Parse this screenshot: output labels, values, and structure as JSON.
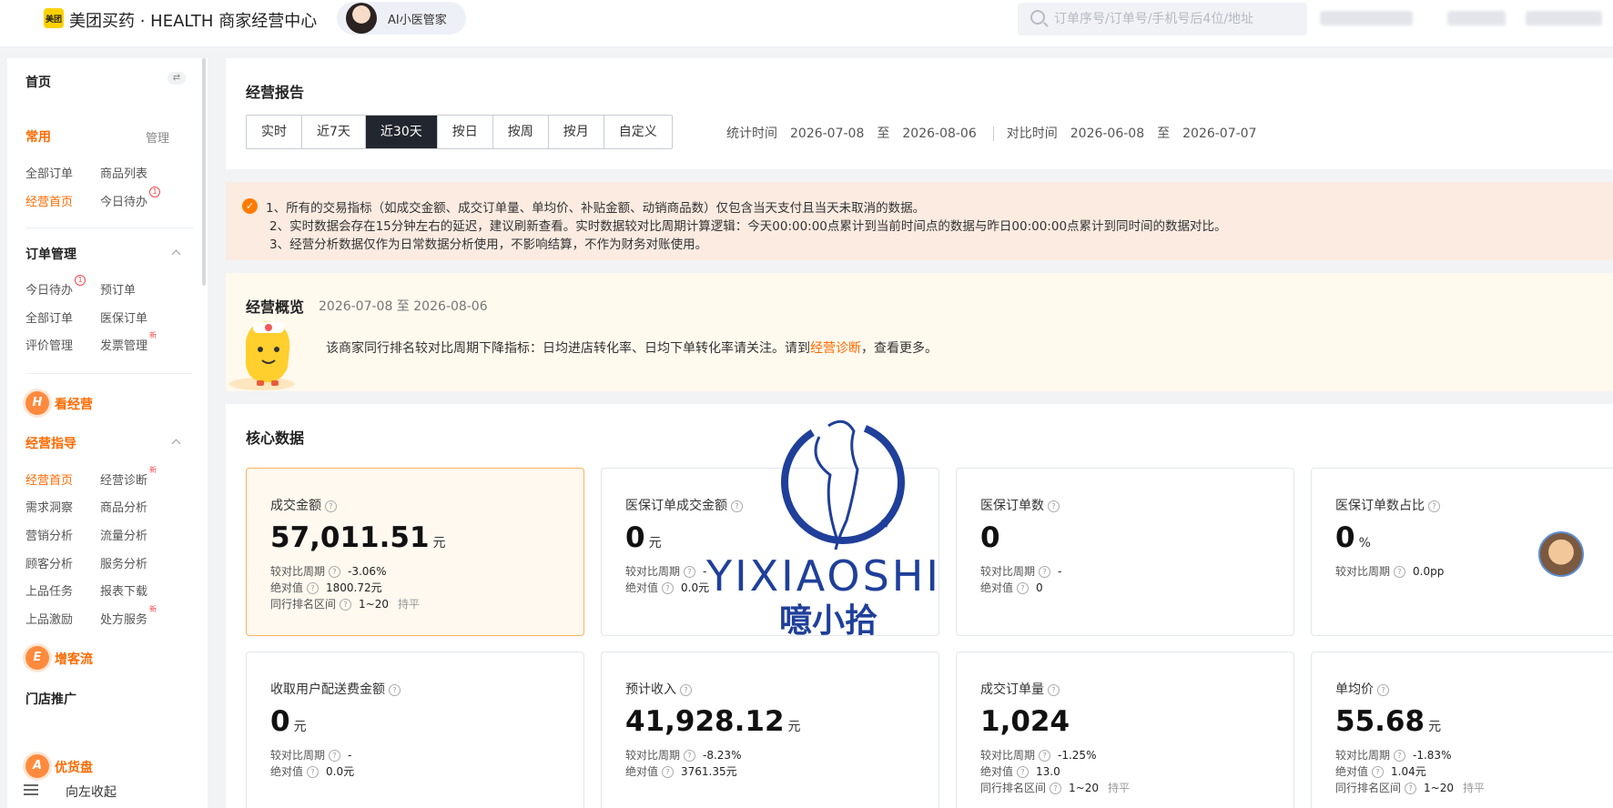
{
  "header": {
    "logo_badge": "美团",
    "brand": "美团买药 · HEALTH 商家经营中心",
    "ai_assistant": "AI小医管家",
    "search_placeholder": "订单序号/订单号/手机号后4位/地址"
  },
  "sidebar": {
    "home": "首页",
    "common": "常用",
    "manage": "管理",
    "common_items": [
      {
        "label": "全部订单"
      },
      {
        "label": "商品列表"
      },
      {
        "label": "经营首页"
      },
      {
        "label": "今日待办",
        "badge": "1"
      }
    ],
    "order_mgmt": "订单管理",
    "order_items": [
      {
        "label": "今日待办",
        "badge": "1"
      },
      {
        "label": "预订单"
      },
      {
        "label": "全部订单"
      },
      {
        "label": "医保订单"
      },
      {
        "label": "评价管理"
      },
      {
        "label": "发票管理",
        "new": "新"
      }
    ],
    "kan_jingying": {
      "icon_letter": "H",
      "label": "看经营"
    },
    "guide": "经营指导",
    "guide_items": [
      {
        "label": "经营首页"
      },
      {
        "label": "经营诊断",
        "new": "新"
      },
      {
        "label": "需求洞察"
      },
      {
        "label": "商品分析"
      },
      {
        "label": "营销分析"
      },
      {
        "label": "流量分析"
      },
      {
        "label": "顾客分析"
      },
      {
        "label": "服务分析"
      },
      {
        "label": "上品任务"
      },
      {
        "label": "报表下载"
      },
      {
        "label": "上品激励"
      },
      {
        "label": "处方服务",
        "new": "新"
      }
    ],
    "zeng_keliu": {
      "icon_letter": "E",
      "label": "增客流"
    },
    "store_promo": "门店推广",
    "you_huopan": {
      "icon_letter": "A",
      "label": "优货盘"
    },
    "collapse": "向左收起"
  },
  "report": {
    "title": "经营报告",
    "periods": [
      "实时",
      "近7天",
      "近30天",
      "按日",
      "按周",
      "按月",
      "自定义"
    ],
    "active_period": "近30天",
    "stat_label": "统计时间",
    "stat_start": "2026-07-08",
    "to": "至",
    "stat_end": "2026-08-06",
    "compare_label": "对比时间",
    "compare_start": "2026-06-08",
    "compare_end": "2026-07-07"
  },
  "notice": {
    "icon": "✓",
    "lines": [
      "1、所有的交易指标（如成交金额、成交订单量、单均价、补贴金额、动销商品数）仅包含当天支付且当天未取消的数据。",
      "2、实时数据会存在15分钟左右的延迟，建议刷新查看。实时数据较对比周期计算逻辑：今天00:00:00点累计到当前时间点的数据与昨日00:00:00点累计到同时间的数据对比。",
      "3、经营分析数据仅作为日常数据分析使用，不影响结算，不作为财务对账使用。"
    ]
  },
  "overview": {
    "title": "经营概览",
    "range": "2026-07-08 至 2026-08-06",
    "text_before": "该商家同行排名较对比周期下降指标：日均进店转化率、日均下单转化率请关注。请到",
    "link": "经营诊断",
    "text_after": "，查看更多。"
  },
  "core": {
    "title": "核心数据",
    "cards": [
      {
        "label": "成交金额",
        "value": "57,011.51",
        "unit": "元",
        "cmp_label": "较对比周期",
        "cmp": "-3.06%",
        "abs_label": "绝对值",
        "abs": "1800.72元",
        "rank_label": "同行排名区间",
        "rank": "1~20",
        "rank_trend": "持平"
      },
      {
        "label": "医保订单成交金额",
        "value": "0",
        "unit": "元",
        "cmp_label": "较对比周期",
        "cmp": "-",
        "abs_label": "绝对值",
        "abs": "0.0元"
      },
      {
        "label": "医保订单数",
        "value": "0",
        "unit": "",
        "cmp_label": "较对比周期",
        "cmp": "-",
        "abs_label": "绝对值",
        "abs": "0"
      },
      {
        "label": "医保订单数占比",
        "value": "0",
        "unit": "%",
        "cmp_label": "较对比周期",
        "cmp": "0.0pp"
      },
      {
        "label": "收取用户配送费金额",
        "value": "0",
        "unit": "元",
        "cmp_label": "较对比周期",
        "cmp": "-",
        "abs_label": "绝对值",
        "abs": "0.0元"
      },
      {
        "label": "预计收入",
        "value": "41,928.12",
        "unit": "元",
        "cmp_label": "较对比周期",
        "cmp": "-8.23%",
        "abs_label": "绝对值",
        "abs": "3761.35元"
      },
      {
        "label": "成交订单量",
        "value": "1,024",
        "unit": "",
        "cmp_label": "较对比周期",
        "cmp": "-1.25%",
        "abs_label": "绝对值",
        "abs": "13.0",
        "rank_label": "同行排名区间",
        "rank": "1~20",
        "rank_trend": "持平"
      },
      {
        "label": "单均价",
        "value": "55.68",
        "unit": "元",
        "cmp_label": "较对比周期",
        "cmp": "-1.83%",
        "abs_label": "绝对值",
        "abs": "1.04元",
        "rank_label": "同行排名区间",
        "rank": "1~20",
        "rank_trend": "持平"
      }
    ]
  },
  "watermark": {
    "latin": "YIXIAOSHI",
    "cn": "噫小拾"
  },
  "colors": {
    "accent": "#ff6a00",
    "dark_tab": "#22262e",
    "notice_bg": "#fbebe1",
    "watermark": "#1f3f9a"
  }
}
